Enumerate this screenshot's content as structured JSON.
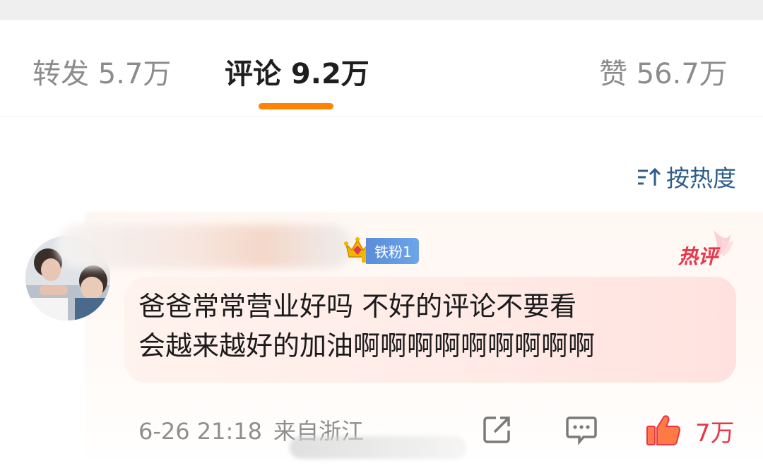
{
  "tabs": [
    {
      "label": "转发 5.7万"
    },
    {
      "label": "评论 9.2万"
    },
    {
      "label": "赞 56.7万"
    }
  ],
  "colors": {
    "accent": "#ff8200",
    "link": "#2d5d8a",
    "hot": "#e8364a",
    "badge": "#5b8dd9"
  },
  "sort": {
    "label": "按热度",
    "icon": "sort-icon"
  },
  "comment": {
    "badge": {
      "label": "铁粉1",
      "icon": "crown-icon"
    },
    "hot_tag": "热评",
    "lines": [
      "爸爸常常营业好吗 不好的评论不要看",
      "会越来越好的加油啊啊啊啊啊啊啊啊啊"
    ],
    "date": "6-26 21:18",
    "location": "来自浙江",
    "likes": "7万"
  }
}
